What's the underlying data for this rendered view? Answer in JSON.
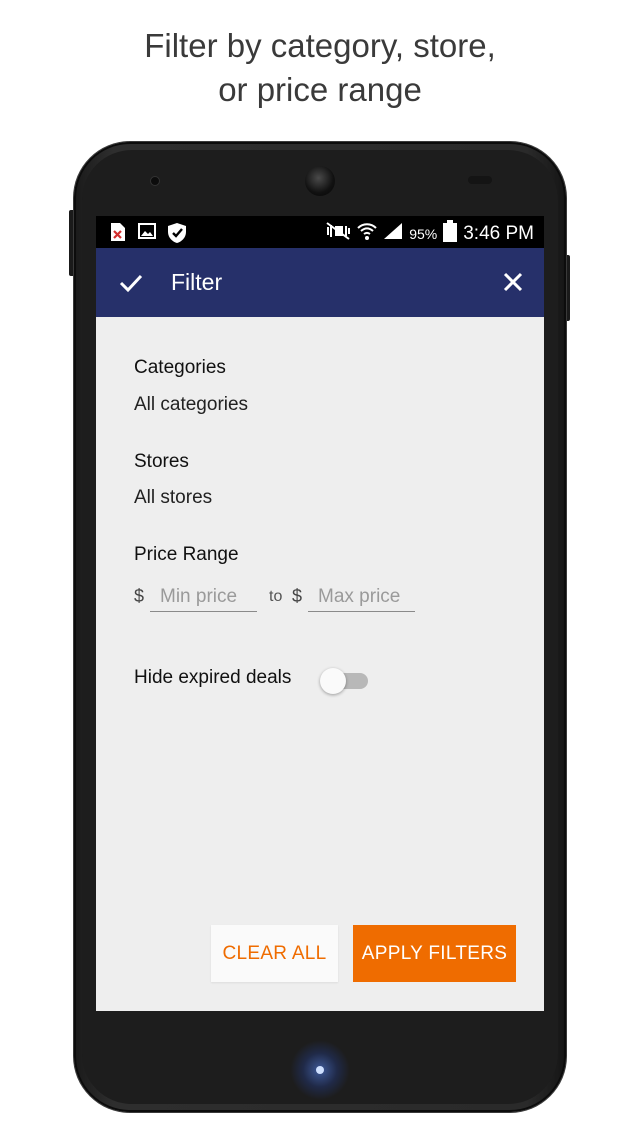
{
  "caption": {
    "line1": "Filter by category, store,",
    "line2": "or price range"
  },
  "status_bar": {
    "battery_percent": "95%",
    "time": "3:46 PM",
    "icons": [
      "file-error-icon",
      "image-icon",
      "shield-icon",
      "mute-icon",
      "wifi-icon",
      "signal-icon",
      "battery-icon"
    ]
  },
  "app_bar": {
    "title": "Filter",
    "confirm_icon": "check-icon",
    "close_icon": "close-icon",
    "background": "#26306a"
  },
  "filters": {
    "categories": {
      "label": "Categories",
      "value": "All categories"
    },
    "stores": {
      "label": "Stores",
      "value": "All stores"
    },
    "price_range": {
      "label": "Price Range",
      "currency": "$",
      "min_placeholder": "Min price",
      "min_value": "",
      "separator": "to",
      "max_placeholder": "Max price",
      "max_value": ""
    },
    "hide_expired": {
      "label": "Hide expired deals",
      "enabled": false
    }
  },
  "actions": {
    "clear_label": "CLEAR ALL",
    "apply_label": "APPLY FILTERS",
    "accent": "#ef6c00"
  }
}
